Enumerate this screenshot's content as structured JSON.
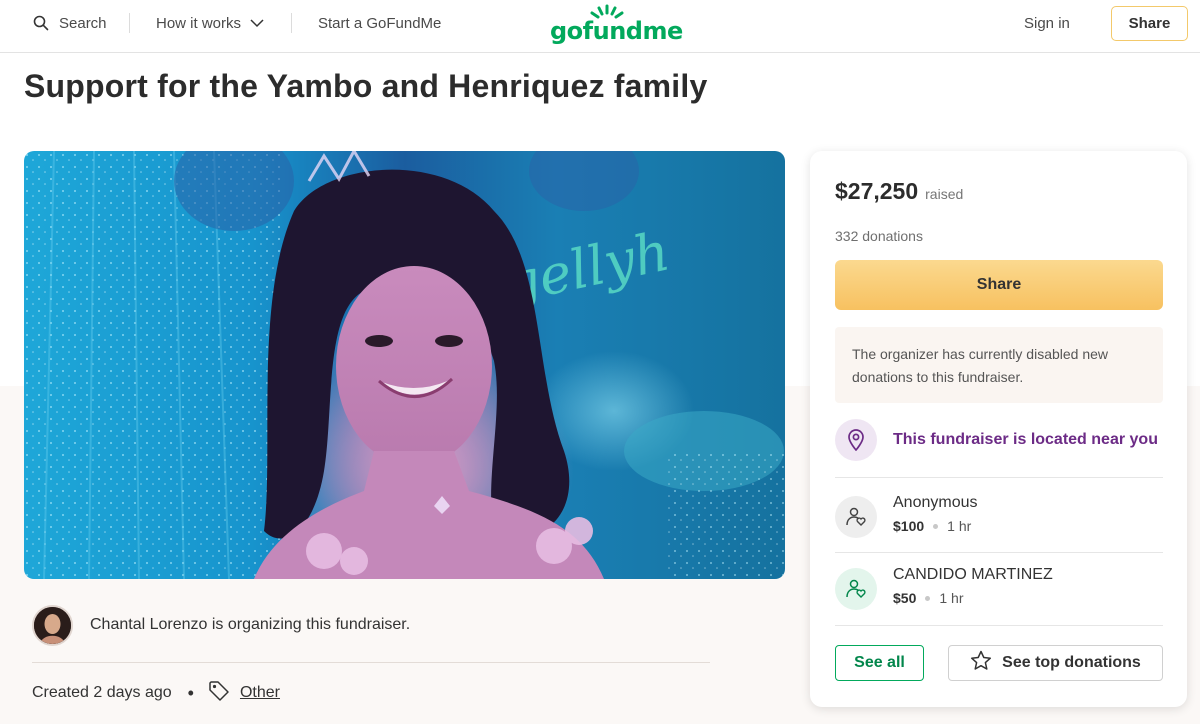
{
  "header": {
    "search_label": "Search",
    "how_it_works_label": "How it works",
    "start_label": "Start a GoFundMe",
    "logo_text": "gofundme",
    "signin_label": "Sign in",
    "share_label": "Share"
  },
  "page": {
    "title": "Support for the Yambo and Henriquez family"
  },
  "organizer": {
    "text": "Chantal Lorenzo is organizing this fundraiser.",
    "created": "Created 2 days ago",
    "separator": "•",
    "category": "Other"
  },
  "card": {
    "raised_amount": "$27,250",
    "raised_label": "raised",
    "donations_count": "332 donations",
    "share_label": "Share",
    "notice": "The organizer has currently disabled new donations to this fundraiser.",
    "location_text": "This fundraiser is located near you",
    "donations": [
      {
        "name": "Anonymous",
        "amount": "$100",
        "time": "1 hr"
      },
      {
        "name": "CANDIDO MARTINEZ",
        "amount": "$50",
        "time": "1 hr"
      }
    ],
    "see_all_label": "See all",
    "see_top_label": "See top donations"
  },
  "colors": {
    "brand_green": "#02a95c",
    "share_yellow": "#f7c160",
    "location_purple": "#6c2b86"
  }
}
